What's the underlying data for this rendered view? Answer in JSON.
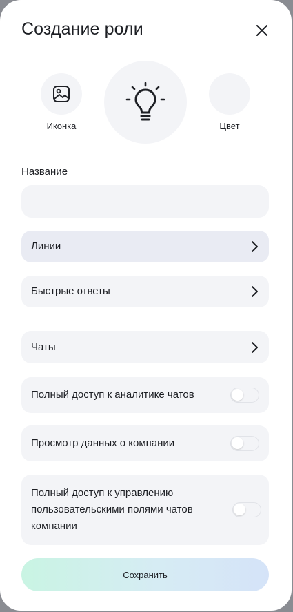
{
  "modal": {
    "title": "Создание роли",
    "close_icon": "close-icon"
  },
  "icon_picker": {
    "icon_label": "Иконка",
    "color_label": "Цвет",
    "selected_icon": "lightbulb-icon",
    "image_icon": "image-icon"
  },
  "name_field": {
    "label": "Название",
    "value": "",
    "placeholder": ""
  },
  "nav_rows": [
    {
      "label": "Линии",
      "icon": "chevron-right-icon"
    },
    {
      "label": "Быстрые ответы",
      "icon": "chevron-right-icon"
    },
    {
      "label": "Чаты",
      "icon": "chevron-right-icon"
    }
  ],
  "toggle_rows": [
    {
      "label": "Полный доступ к аналитике чатов",
      "enabled": false
    },
    {
      "label": "Просмотр данных о компании",
      "enabled": false
    },
    {
      "label": "Полный доступ к управлению пользовательскими полями чатов компании",
      "enabled": false
    }
  ],
  "save_label": "Сохранить",
  "colors": {
    "surface": "#ffffff",
    "field_bg": "#f3f4f7",
    "active_row_bg": "#e9ebf3",
    "text": "#1d1f24",
    "save_gradient_start": "#c9f4e3",
    "save_gradient_end": "#d5e3f8"
  }
}
